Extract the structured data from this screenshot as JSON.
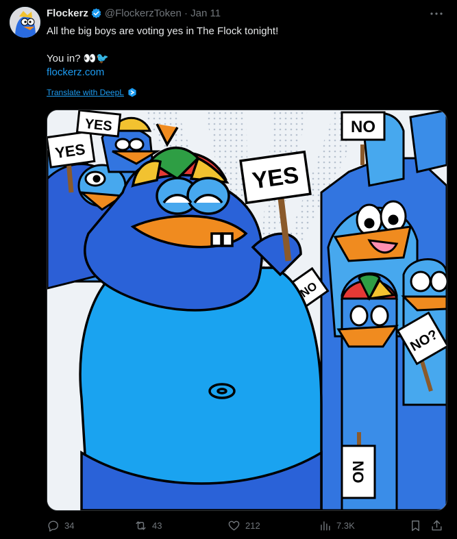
{
  "tweet": {
    "author_name": "Flockerz",
    "handle_and_date": "@FlockerzToken · Jan 11",
    "text_line1": "All the big boys are voting yes in The Flock tonight!",
    "text_line2": "You in? 👀🐦",
    "link": "flockerz.com",
    "translate": "Translate with DeepL",
    "image_signs": {
      "yes_big": "YES",
      "yes_small_1": "YES",
      "yes_small_2": "YES",
      "no_top": "NO",
      "no_mid": "NO",
      "no_q": "NO?",
      "no_bottom": "NO"
    }
  },
  "actions": {
    "replies": "34",
    "reposts": "43",
    "likes": "212",
    "views": "7.3K"
  },
  "colors": {
    "background": "#000000",
    "text": "#e7e9ea",
    "muted": "#71767b",
    "accent": "#1d9bf0"
  }
}
